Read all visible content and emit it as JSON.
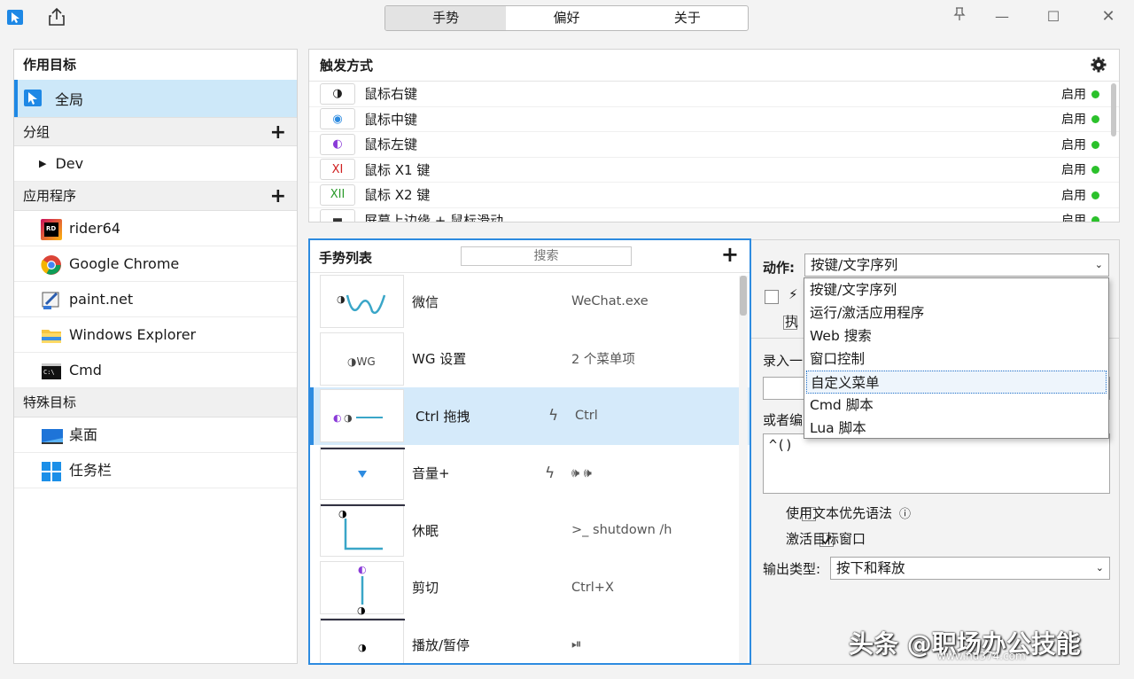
{
  "titlebar": {
    "tabs": [
      "手势",
      "偏好",
      "关于"
    ],
    "active_tab": 0,
    "pin": "⚲",
    "minimize": "—",
    "maximize": "☐",
    "close": "✕"
  },
  "targets": {
    "title": "作用目标",
    "global_label": "全局",
    "groups_header": "分组",
    "groups": [
      "Dev"
    ],
    "apps_header": "应用程序",
    "apps": [
      "rider64",
      "Google Chrome",
      "paint.net",
      "Windows Explorer",
      "Cmd"
    ],
    "special_header": "特殊目标",
    "special": [
      "桌面",
      "任务栏"
    ]
  },
  "triggers": {
    "title": "触发方式",
    "items": [
      {
        "label": "鼠标右键",
        "status": "启用",
        "icon": "◑"
      },
      {
        "label": "鼠标中键",
        "status": "启用",
        "icon": "◉"
      },
      {
        "label": "鼠标左键",
        "status": "启用",
        "icon": "◐"
      },
      {
        "label": "鼠标 X1 键",
        "status": "启用",
        "icon": "XI"
      },
      {
        "label": "鼠标 X2 键",
        "status": "启用",
        "icon": "XII"
      },
      {
        "label": "屏幕上边缘 + 鼠标滑动",
        "status": "启用",
        "icon": "▬"
      }
    ]
  },
  "gestures": {
    "title": "手势列表",
    "search_placeholder": "搜索",
    "items": [
      {
        "name": "微信",
        "desc": "WeChat.exe",
        "flash": false
      },
      {
        "name": "WG 设置",
        "desc": "2 个菜单项",
        "flash": false
      },
      {
        "name": "Ctrl 拖拽",
        "desc": "Ctrl",
        "flash": true
      },
      {
        "name": "音量+",
        "desc": "🕪 🕪",
        "flash": true
      },
      {
        "name": "休眠",
        "desc": ">_ shutdown /h",
        "flash": false
      },
      {
        "name": "剪切",
        "desc": "Ctrl+X",
        "flash": false
      },
      {
        "name": "播放/暂停",
        "desc": "⏯",
        "flash": false
      }
    ],
    "thumb_text_wg": "◑WG"
  },
  "action": {
    "label": "动作:",
    "selected": "按键/文字序列",
    "options": [
      "按键/文字序列",
      "运行/激活应用程序",
      "Web 搜索",
      "窗口控制",
      "自定义菜单",
      "Cmd 脚本",
      "Lua 脚本"
    ],
    "highlighted_index": 4,
    "exec_label": "执",
    "record_label": "录入一",
    "or_edit_label": "或者编",
    "script_text": "^()",
    "use_text_first": "使用文本优先语法",
    "activate_window": "激活目标窗口",
    "output_type_label": "输出类型:",
    "output_type_value": "按下和释放"
  },
  "watermark": "头条 @职场办公技能",
  "watermark_sub": "www.nu374.com"
}
